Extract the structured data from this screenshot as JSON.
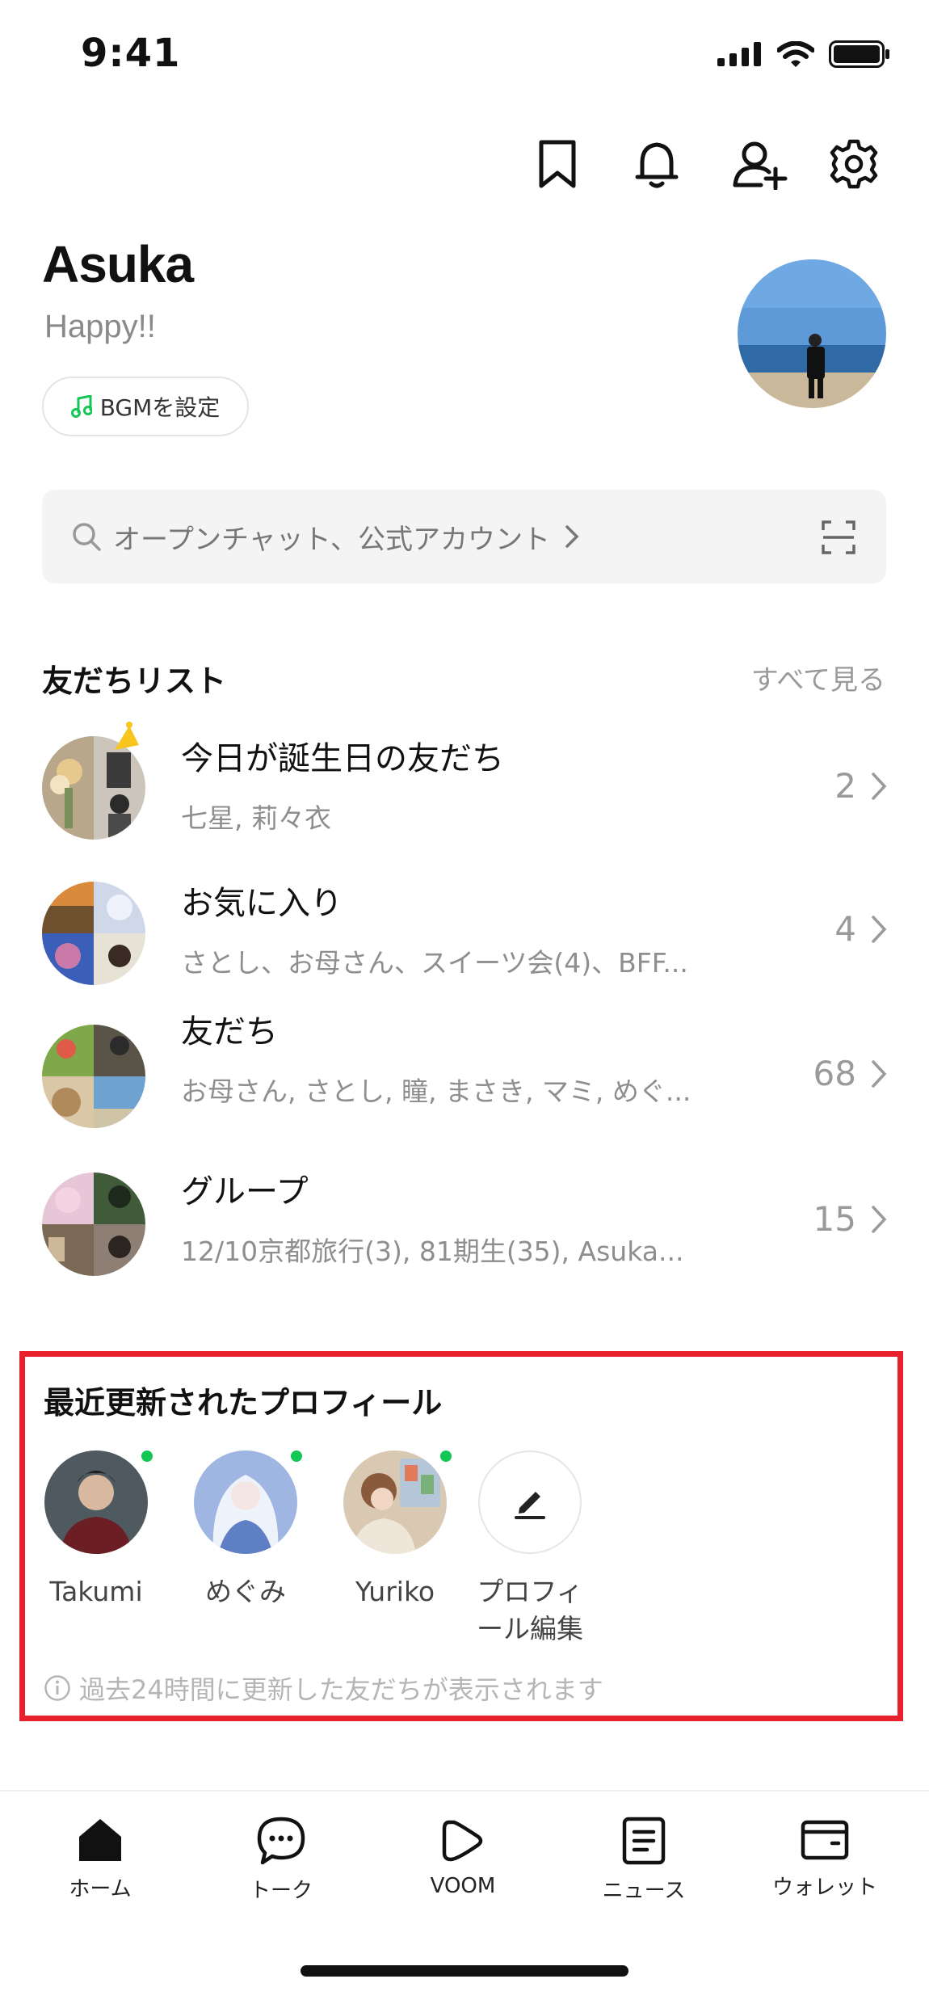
{
  "status_bar": {
    "time": "9:41"
  },
  "profile": {
    "name": "Asuka",
    "status_message": "Happy!!",
    "bgm_label": "BGMを設定"
  },
  "search": {
    "placeholder": "オープンチャット、公式アカウント"
  },
  "friends_list": {
    "title": "友だちリスト",
    "see_all": "すべて見る",
    "rows": [
      {
        "title": "今日が誕生日の友だち",
        "subtitle": "七星, 莉々衣",
        "count": "2"
      },
      {
        "title": "お気に入り",
        "subtitle": "さとし、お母さん、スイーツ会(4)、BFF...",
        "count": "4"
      },
      {
        "title": "友だち",
        "subtitle": "お母さん, さとし, 瞳,  まさき, マミ,  めぐ...",
        "count": "68"
      },
      {
        "title": "グループ",
        "subtitle": "12/10京都旅行(3), 81期生(35), Asuka...",
        "count": "15"
      }
    ]
  },
  "recent_profiles": {
    "title": "最近更新されたプロフィール",
    "friends": [
      {
        "name": "Takumi"
      },
      {
        "name": "めぐみ"
      },
      {
        "name": "Yuriko"
      }
    ],
    "edit_label_line1": "プロフィ",
    "edit_label_line2": "ール編集",
    "note": "過去24時間に更新した友だちが表示されます"
  },
  "bottom_nav": {
    "items": [
      {
        "label": "ホーム",
        "icon": "home-icon"
      },
      {
        "label": "トーク",
        "icon": "chat-bubble-icon"
      },
      {
        "label": "VOOM",
        "icon": "voom-play-icon"
      },
      {
        "label": "ニュース",
        "icon": "news-icon"
      },
      {
        "label": "ウォレット",
        "icon": "wallet-icon"
      }
    ]
  },
  "colors": {
    "accent_green": "#14c653",
    "highlight_red": "#e8212c",
    "muted_text": "#8e8e8e"
  }
}
